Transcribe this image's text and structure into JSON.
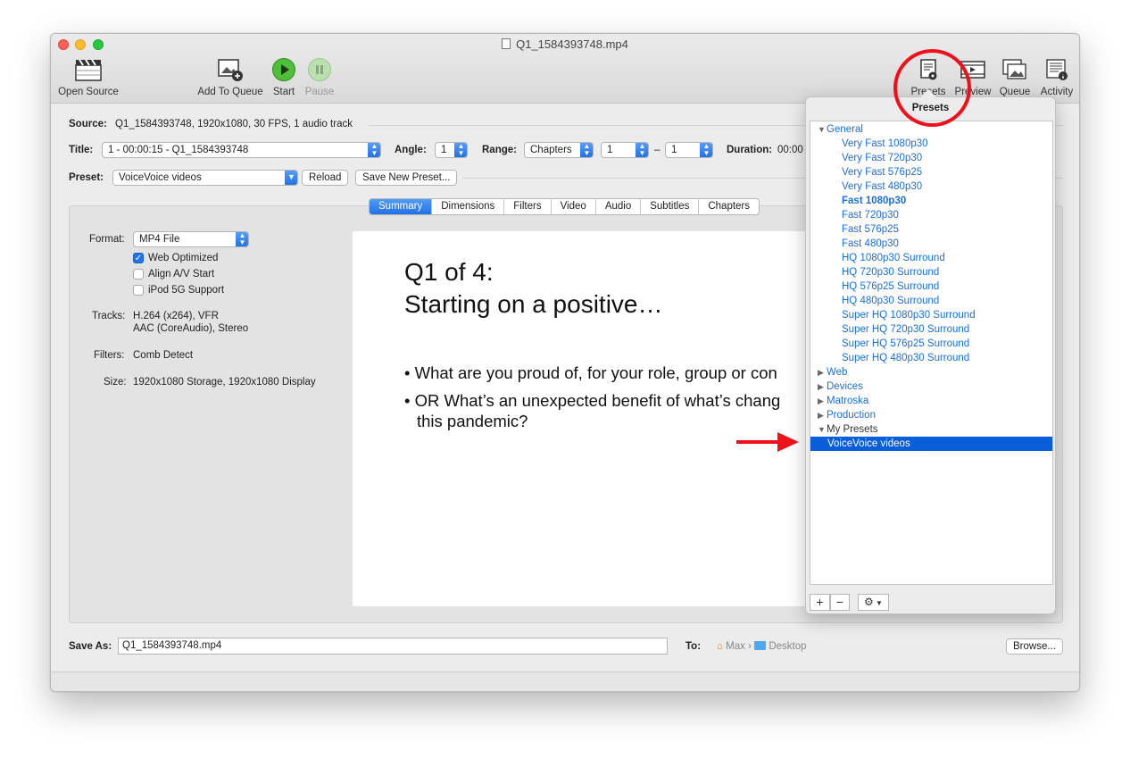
{
  "window": {
    "title": "Q1_1584393748.mp4"
  },
  "toolbar": {
    "open_source": "Open Source",
    "add_to_queue": "Add To Queue",
    "start": "Start",
    "pause": "Pause",
    "presets": "Presets",
    "preview": "Preview",
    "queue": "Queue",
    "activity": "Activity"
  },
  "source": {
    "label": "Source:",
    "value": "Q1_1584393748, 1920x1080, 30 FPS, 1 audio track"
  },
  "title_row": {
    "title_label": "Title:",
    "title_value": "1 - 00:00:15 - Q1_1584393748",
    "angle_label": "Angle:",
    "angle_value": "1",
    "range_label": "Range:",
    "range_type": "Chapters",
    "range_start": "1",
    "range_dash": "–",
    "range_end": "1",
    "duration_label": "Duration:",
    "duration_value": "00:00"
  },
  "preset_row": {
    "label": "Preset:",
    "value": "VoiceVoice videos",
    "reload": "Reload",
    "save_new": "Save New Preset..."
  },
  "tabs": [
    "Summary",
    "Dimensions",
    "Filters",
    "Video",
    "Audio",
    "Subtitles",
    "Chapters"
  ],
  "summary": {
    "format_label": "Format:",
    "format_value": "MP4 File",
    "web_optimized": "Web Optimized",
    "web_optimized_checked": true,
    "align_av": "Align A/V Start",
    "align_av_checked": false,
    "ipod": "iPod 5G Support",
    "ipod_checked": false,
    "tracks_label": "Tracks:",
    "tracks_line1": "H.264 (x264), VFR",
    "tracks_line2": "AAC (CoreAudio), Stereo",
    "filters_label": "Filters:",
    "filters_value": "Comb Detect",
    "size_label": "Size:",
    "size_value": "1920x1080 Storage, 1920x1080 Display"
  },
  "preview_slide": {
    "title_line1": "Q1 of 4:",
    "title_line2": "Starting on a positive…",
    "bullet1": "What are you proud of, for your role, group or con",
    "bullet2_line1": "OR What’s an unexpected benefit of what’s chang",
    "bullet2_line2": "this pandemic?"
  },
  "save": {
    "label": "Save As:",
    "value": "Q1_1584393748.mp4",
    "to_label": "To:",
    "path_user": "Max",
    "path_sep": "›",
    "path_folder": "Desktop",
    "browse": "Browse..."
  },
  "presets_popover": {
    "title": "Presets",
    "groups": [
      {
        "label": "General",
        "expanded": true
      },
      {
        "label": "Web",
        "expanded": false
      },
      {
        "label": "Devices",
        "expanded": false
      },
      {
        "label": "Matroska",
        "expanded": false
      },
      {
        "label": "Production",
        "expanded": false
      },
      {
        "label": "My Presets",
        "expanded": true
      }
    ],
    "general_presets": [
      "Very Fast 1080p30",
      "Very Fast 720p30",
      "Very Fast 576p25",
      "Very Fast 480p30",
      "Fast 1080p30",
      "Fast 720p30",
      "Fast 576p25",
      "Fast 480p30",
      "HQ 1080p30 Surround",
      "HQ 720p30 Surround",
      "HQ 576p25 Surround",
      "HQ 480p30 Surround",
      "Super HQ 1080p30 Surround",
      "Super HQ 720p30 Surround",
      "Super HQ 576p25 Surround",
      "Super HQ 480p30 Surround"
    ],
    "default_preset": "Fast 1080p30",
    "my_presets": [
      "VoiceVoice videos"
    ],
    "selected": "VoiceVoice videos",
    "add": "+",
    "remove": "−",
    "gear": "⚙"
  },
  "colors": {
    "accent": "#1f6fe6",
    "link_blue": "#1a6fdb",
    "selection": "#0b5ed9",
    "annotation_red": "#f0101a"
  }
}
